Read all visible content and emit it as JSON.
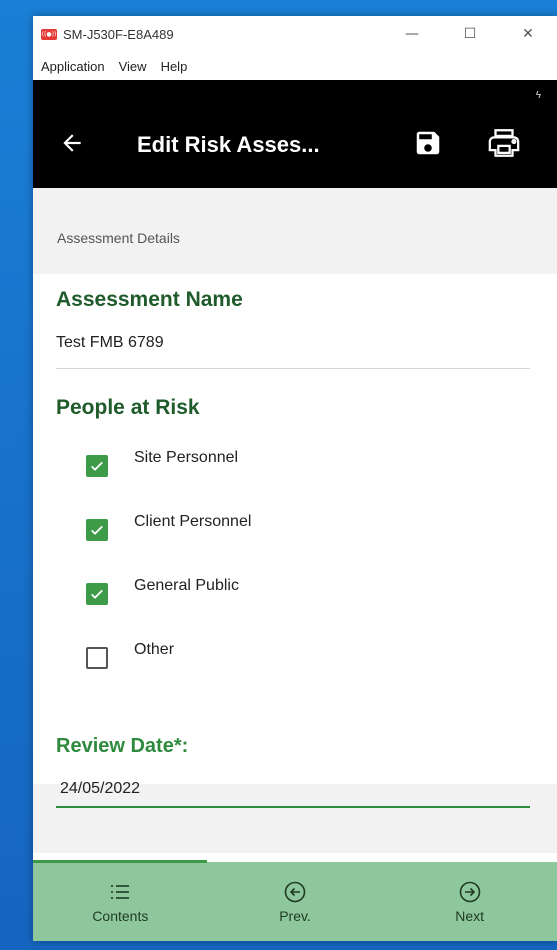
{
  "window": {
    "title": "SM-J530F-E8A489",
    "logo_text": "((●))",
    "minimize": "—",
    "maximize": "☐",
    "close": "✕"
  },
  "menu": {
    "items": [
      "Application",
      "View",
      "Help"
    ]
  },
  "header": {
    "status_icon": "ϟ",
    "title": "Edit Risk Asses..."
  },
  "content": {
    "section_title": "Assessment Details",
    "assessment_name": {
      "label": "Assessment Name",
      "value": "Test FMB 6789"
    },
    "people_at_risk": {
      "label": "People at Risk",
      "options": [
        {
          "label": "Site Personnel",
          "checked": true
        },
        {
          "label": "Client Personnel",
          "checked": true
        },
        {
          "label": "General Public",
          "checked": true
        },
        {
          "label": "Other",
          "checked": false
        }
      ]
    },
    "review_date": {
      "label": "Review Date*:",
      "value": "24/05/2022"
    }
  },
  "nav": {
    "items": [
      {
        "label": "Contents",
        "icon": "list-icon"
      },
      {
        "label": "Prev.",
        "icon": "arrow-left-circle-icon"
      },
      {
        "label": "Next",
        "icon": "arrow-right-circle-icon"
      }
    ]
  },
  "colors": {
    "header_bg": "#000000",
    "label_green": "#1f5b2b",
    "accent_green": "#2e8b3e",
    "checkbox_green": "#3d9b47",
    "nav_bg": "#8ec79c"
  }
}
